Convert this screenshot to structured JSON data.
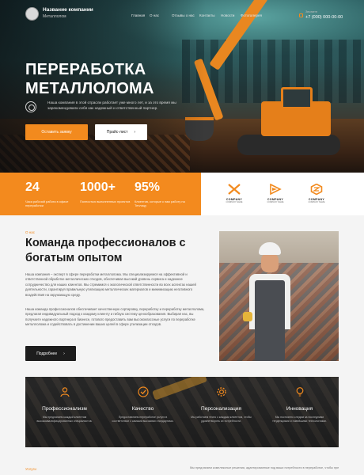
{
  "header": {
    "company_name": "Название компании",
    "company_sub": "Металлолом",
    "menu": [
      "Главная",
      "О нас",
      "Отзывы о нас",
      "Контакты",
      "Новости",
      "Фотогалерея"
    ],
    "phone_label": "Звоните",
    "phone_number": "+7 (000) 000-00-00"
  },
  "hero": {
    "title_line1": "ПЕРЕРАБОТКА",
    "title_line2": "МЕТАЛЛОЛОМА",
    "description": "Наша компания в этой отрасли работает уже много лет, и за это время мы зарекомендовали себя как надежный и ответственный партнер.",
    "cta_primary": "Оставить заявку",
    "cta_secondary": "Прайс-лист",
    "cta_secondary_arrow": "›"
  },
  "stats": [
    {
      "value": "24",
      "text": "Часа рабочий работа в офисе переработки"
    },
    {
      "value": "1000+",
      "text": "Полностью выполненных проектов"
    },
    {
      "value": "95%",
      "text": "Клиентов, которые к нам работу на Теплицу"
    }
  ],
  "partners": [
    {
      "icon": "chevrons-x-logo-icon",
      "name": "COMPANY",
      "tagline": "COMPANY NAME"
    },
    {
      "icon": "arrows-logo-icon",
      "name": "COMPANY",
      "tagline": "COMPANY NAME"
    },
    {
      "icon": "hexagon-logo-icon",
      "name": "COMPANY",
      "tagline": "COMPANY NAME"
    }
  ],
  "about": {
    "tag": "О нас",
    "title": "Команда профессионалов с богатым опытом",
    "paragraph1": "Наша компания – эксперт в сфере переработки металлолома. Мы специализируемся на эффективной и ответственной обработке металлических отходов, обеспечивая высокий уровень сервиса и надежное сотрудничество для наших клиентов. Мы стремимся к экологической ответственности во всех аспектах нашей деятельности, гарантируя правильную утилизацию металлических материалов и минимизацию негативного воздействия на окружающую среду.",
    "paragraph2": "Наша команда профессионалов обеспечивает качественную сортировку, переработку и переработку металлолома, предлагая индивидуальный подход к каждому клиенту и гибкую систему ценообразования. Выбирая нас, вы получаете надежного партнера в бизнесе, готового предоставить вам высококлассные услуги по переработке металлолома и содействовать в достижении ваших целей в сфере утилизации отходов.",
    "button": "Подробнее",
    "button_arrow": "›"
  },
  "features": [
    {
      "icon": "user-icon",
      "title": "Профессионализм",
      "text": "Мы предлагаем каждый клиентам высококвалифицированных специалистов."
    },
    {
      "icon": "checkmark-icon",
      "title": "Качество",
      "text": "Предоставляем переработке услуги в соответствии с самыми высокими стандартами."
    },
    {
      "icon": "gear-icon",
      "title": "Персонализация",
      "text": "Мы работаем тесно с каждым клиентом, чтобы удовлетворить их потребности."
    },
    {
      "icon": "bulb-icon",
      "title": "Инновация",
      "text": "Мы постоянно следим за последними тенденциями и новейшими технологиями."
    }
  ],
  "services": {
    "tag": "Услуги",
    "text": "Мы предлагаем комплексные решения, адаптированные под ваши потребности в переработке, чтобы превратить"
  },
  "colors": {
    "accent": "#f28a1e",
    "dark": "#1d1d1d",
    "background": "#f4f4f4"
  }
}
